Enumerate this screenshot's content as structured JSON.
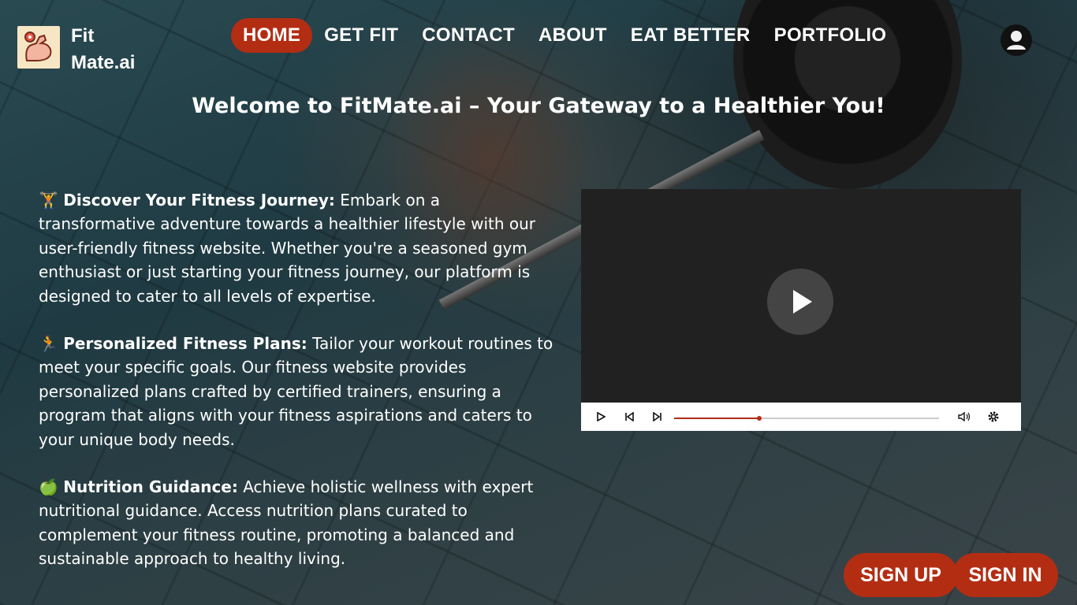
{
  "brand": {
    "line1": "Fit",
    "line2": "Mate.ai"
  },
  "nav": {
    "items": [
      {
        "label": "HOME",
        "active": true
      },
      {
        "label": "GET FIT"
      },
      {
        "label": "CONTACT"
      },
      {
        "label": "ABOUT"
      },
      {
        "label": "EAT BETTER"
      },
      {
        "label": "PORTFOLIO"
      }
    ]
  },
  "hero": {
    "headline": "Welcome to FitMate.ai – Your Gateway to a Healthier You!"
  },
  "sections": [
    {
      "emoji": "🏋",
      "title": "Discover Your Fitness Journey:",
      "text": " Embark on a transformative adventure towards a healthier lifestyle with our user-friendly fitness website. Whether you're a seasoned gym enthusiast or just starting your fitness journey, our platform is designed to cater to all levels of expertise."
    },
    {
      "emoji": "🏃",
      "title": "Personalized Fitness Plans:",
      "text": " Tailor your workout routines to meet your specific goals. Our fitness website provides personalized plans crafted by certified trainers, ensuring a program that aligns with your fitness aspirations and caters to your unique body needs."
    },
    {
      "emoji": "🍏",
      "title": "Nutrition Guidance:",
      "text": " Achieve holistic wellness with expert nutritional guidance. Access nutrition plans curated to complement your fitness routine, promoting a balanced and sustainable approach to healthy living."
    }
  ],
  "video": {
    "progress": 0.32
  },
  "auth": {
    "signup": "SIGN UP",
    "signin": "SIGN IN"
  },
  "colors": {
    "accent": "#b32d13",
    "player_bg": "#212121"
  },
  "icons": {
    "logo": "flexing-arm-icon",
    "profile": "user-circle-icon"
  }
}
